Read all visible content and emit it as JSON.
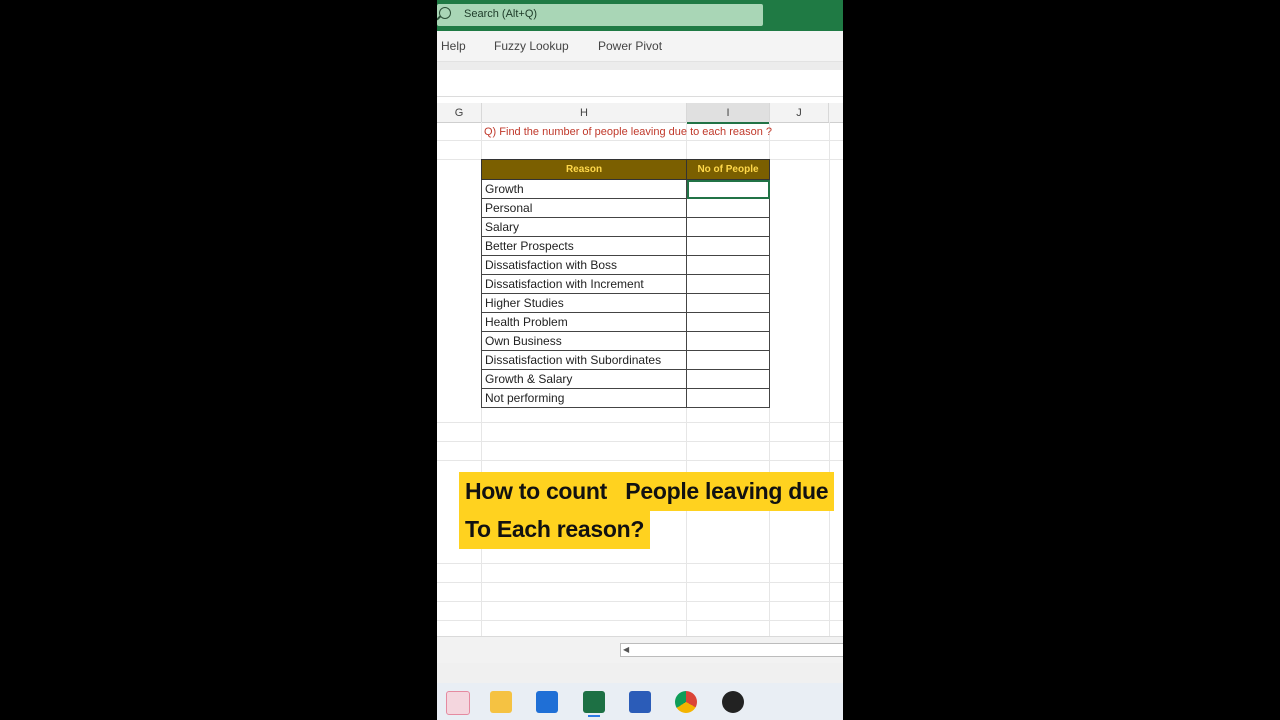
{
  "search": {
    "placeholder": "Search (Alt+Q)"
  },
  "ribbon": {
    "tabs": [
      "Help",
      "Fuzzy Lookup",
      "Power Pivot"
    ]
  },
  "columns": [
    "G",
    "H",
    "I",
    "J"
  ],
  "question": "Q) Find the number of people leaving due to each reason ?",
  "table": {
    "headers": [
      "Reason",
      "No of People"
    ],
    "rows": [
      "Growth",
      "Personal",
      "Salary",
      "Better Prospects",
      "Dissatisfaction with Boss",
      "Dissatisfaction with Increment",
      "Higher Studies",
      "Health Problem",
      "Own Business",
      "Dissatisfaction with Subordinates",
      "Growth & Salary",
      "Not performing"
    ]
  },
  "overlay": {
    "line1": "How to count   People leaving due",
    "line2": "To Each reason?"
  },
  "taskbar": {
    "icons": [
      "snipping-tool-icon",
      "file-explorer-icon",
      "store-icon",
      "excel-icon",
      "word-icon",
      "chrome-icon",
      "media-icon"
    ]
  },
  "colors": {
    "accent": "#217346",
    "header_fill": "#7b5f00",
    "header_text": "#ffd84a",
    "overlay_band": "#ffd21f"
  }
}
